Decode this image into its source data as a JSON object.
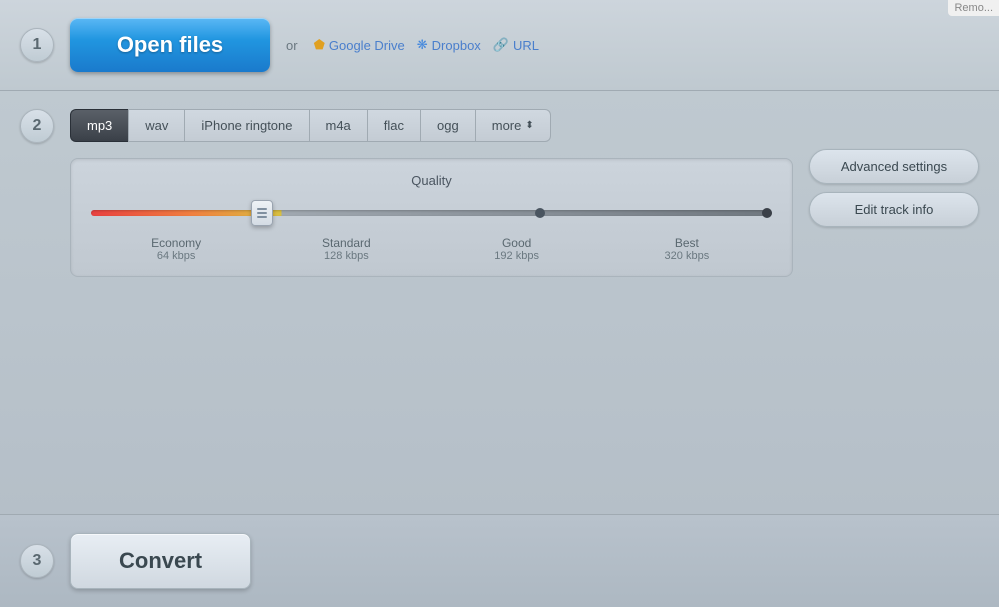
{
  "topRight": {
    "label": "Remo..."
  },
  "section1": {
    "stepNumber": "1",
    "openFilesLabel": "Open files",
    "orText": "or",
    "googleDriveLabel": "Google Drive",
    "dropboxLabel": "Dropbox",
    "urlLabel": "URL"
  },
  "section2": {
    "stepNumber": "2",
    "tabs": [
      {
        "id": "mp3",
        "label": "mp3",
        "active": true
      },
      {
        "id": "wav",
        "label": "wav",
        "active": false
      },
      {
        "id": "iphone-ringtone",
        "label": "iPhone ringtone",
        "active": false
      },
      {
        "id": "m4a",
        "label": "m4a",
        "active": false
      },
      {
        "id": "flac",
        "label": "flac",
        "active": false
      },
      {
        "id": "ogg",
        "label": "ogg",
        "active": false
      },
      {
        "id": "more",
        "label": "more",
        "active": false
      }
    ],
    "qualityLabel": "Quality",
    "markers": [
      {
        "name": "Economy",
        "kbps": "64 kbps"
      },
      {
        "name": "Standard",
        "kbps": "128 kbps"
      },
      {
        "name": "Good",
        "kbps": "192 kbps"
      },
      {
        "name": "Best",
        "kbps": "320 kbps"
      }
    ],
    "advancedSettingsLabel": "Advanced settings",
    "editTrackInfoLabel": "Edit track info"
  },
  "section3": {
    "stepNumber": "3",
    "convertLabel": "Convert"
  }
}
